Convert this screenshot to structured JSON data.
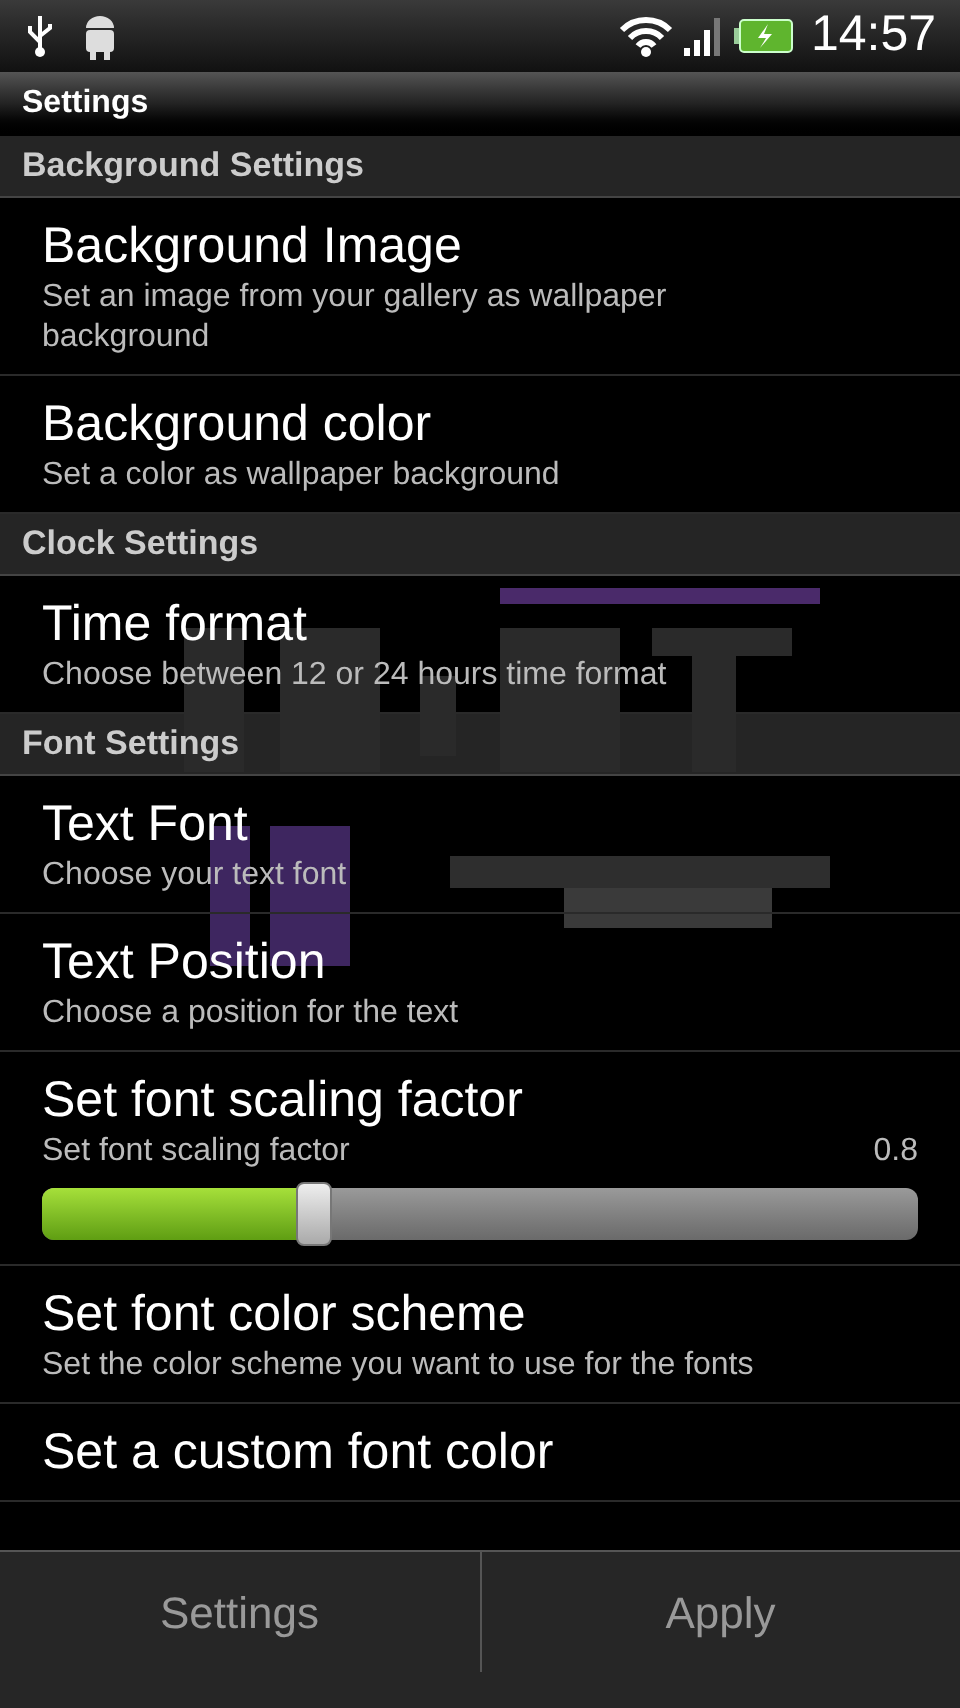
{
  "status_bar": {
    "time": "14:57"
  },
  "title_bar": {
    "title": "Settings"
  },
  "sections": [
    {
      "title": "Background Settings",
      "items": [
        {
          "kind": "entry",
          "title": "Background Image",
          "summary": "Set an image from your gallery as wallpaper background"
        },
        {
          "kind": "entry",
          "title": "Background color",
          "summary": "Set a color as wallpaper background"
        }
      ]
    },
    {
      "title": "Clock Settings",
      "items": [
        {
          "kind": "entry",
          "title": "Time format",
          "summary": "Choose between 12 or 24 hours time format"
        }
      ]
    },
    {
      "title": "Font Settings",
      "items": [
        {
          "kind": "entry",
          "title": "Text Font",
          "summary": "Choose your text font"
        },
        {
          "kind": "entry",
          "title": "Text Position",
          "summary": "Choose a position for the text"
        },
        {
          "kind": "slider",
          "title": "Set font scaling factor",
          "summary": "Set font scaling factor",
          "reading": "0.8",
          "level": 0.31
        },
        {
          "kind": "entry",
          "title": "Set font color scheme",
          "summary": "Set the color scheme you want to use for the fonts"
        },
        {
          "kind": "entry",
          "title": "Set a custom font color"
        }
      ]
    }
  ],
  "bottom_bar": {
    "buttons": [
      "Settings",
      "Apply"
    ]
  }
}
